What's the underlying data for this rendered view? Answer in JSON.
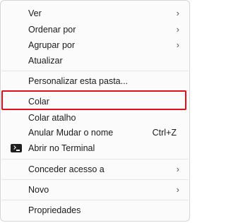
{
  "menu": {
    "items": [
      {
        "label": "Ver",
        "chevron": "›"
      },
      {
        "label": "Ordenar por",
        "chevron": "›"
      },
      {
        "label": "Agrupar por",
        "chevron": "›"
      },
      {
        "label": "Atualizar"
      },
      {
        "label": "Personalizar esta pasta..."
      },
      {
        "label": "Colar"
      },
      {
        "label": "Colar atalho"
      },
      {
        "label": "Anular Mudar o nome",
        "shortcut": "Ctrl+Z"
      },
      {
        "label": "Abrir no Terminal",
        "icon": "terminal-icon"
      },
      {
        "label": "Conceder acesso a",
        "chevron": "›"
      },
      {
        "label": "Novo",
        "chevron": "›"
      },
      {
        "label": "Propriedades"
      }
    ],
    "highlighted_item": "Colar",
    "highlight_color": "#e0101a"
  }
}
